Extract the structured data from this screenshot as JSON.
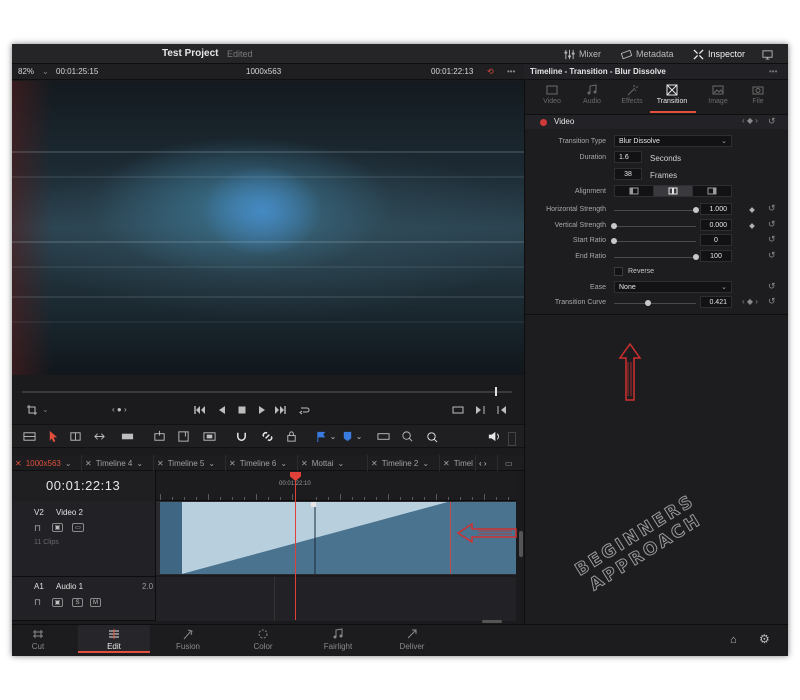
{
  "app": {
    "project_title": "Test Project",
    "project_status": "Edited"
  },
  "topbar": {
    "mixer": "Mixer",
    "metadata": "Metadata",
    "inspector": "Inspector"
  },
  "viewer": {
    "zoom": "82%",
    "source_timecode": "00:01:25:15",
    "resolution": "1000x563",
    "record_timecode": "00:01:22:13"
  },
  "timeline_tabs": [
    {
      "label": "1000x563",
      "active": true
    },
    {
      "label": "Timeline 4"
    },
    {
      "label": "Timeline 5"
    },
    {
      "label": "Timeline 6"
    },
    {
      "label": "Mottai"
    },
    {
      "label": "Timeline 2"
    },
    {
      "label": "Timel"
    }
  ],
  "timeline": {
    "timecode": "00:01:22:13",
    "playhead_label": "00:01:22:10",
    "v2": {
      "id": "V2",
      "name": "Video 2",
      "clips": "11 Clips"
    },
    "a1": {
      "id": "A1",
      "name": "Audio 1",
      "channels": "2.0",
      "solo": "S",
      "mute": "M"
    }
  },
  "inspector": {
    "breadcrumb": "Timeline - Transition - Blur Dissolve",
    "tabs": [
      "Video",
      "Audio",
      "Effects",
      "Transition",
      "Image",
      "File"
    ],
    "active_tab": "Transition",
    "section": "Video",
    "transition_type_label": "Transition Type",
    "transition_type": "Blur Dissolve",
    "duration_label": "Duration",
    "duration_seconds": "1.6",
    "seconds_unit": "Seconds",
    "duration_frames": "38",
    "frames_unit": "Frames",
    "alignment_label": "Alignment",
    "horizontal_strength_label": "Horizontal Strength",
    "horizontal_strength": "1.000",
    "vertical_strength_label": "Vertical Strength",
    "vertical_strength": "0.000",
    "start_ratio_label": "Start Ratio",
    "start_ratio": "0",
    "end_ratio_label": "End Ratio",
    "end_ratio": "100",
    "reverse_label": "Reverse",
    "ease_label": "Ease",
    "ease": "None",
    "transition_curve_label": "Transition Curve",
    "transition_curve": "0.421"
  },
  "pages": [
    {
      "label": "Cut"
    },
    {
      "label": "Edit",
      "active": true
    },
    {
      "label": "Fusion"
    },
    {
      "label": "Color"
    },
    {
      "label": "Fairlight"
    },
    {
      "label": "Deliver"
    }
  ],
  "watermark": {
    "line1": "BEGINNERS",
    "line2": "APPROACH"
  },
  "colors": {
    "accent": "#e0503c",
    "clip": "#4a7390",
    "playhead": "#e0403a"
  }
}
